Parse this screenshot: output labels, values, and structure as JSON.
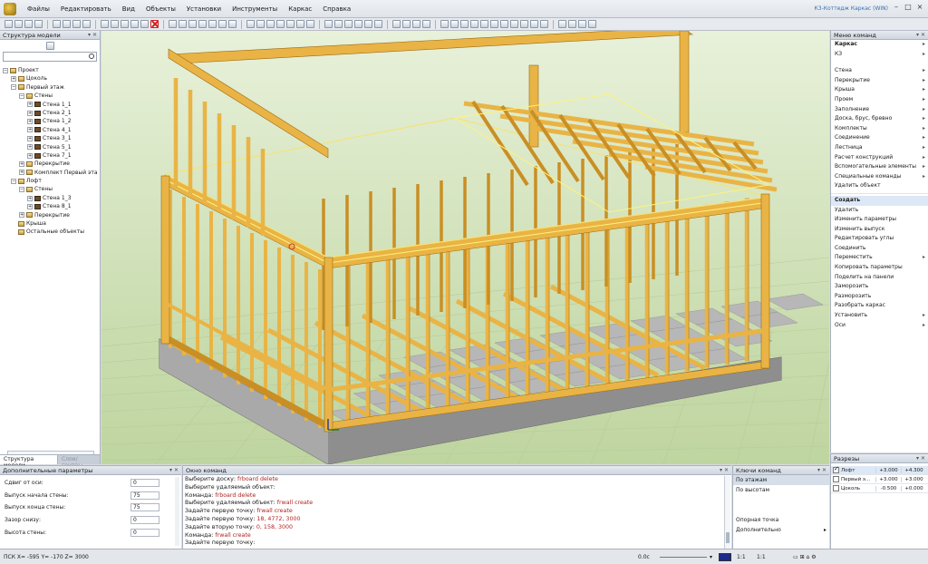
{
  "app": {
    "menus": [
      "Файлы",
      "Редактировать",
      "Вид",
      "Объекты",
      "Установки",
      "Инструменты",
      "Каркас",
      "Справка"
    ],
    "title": "К3-Коттедж Каркас (WIN)",
    "win_controls": {
      "minimize": "–",
      "maximize": "□",
      "close": "×"
    }
  },
  "model_tree": {
    "title": "Структура модели",
    "items": [
      {
        "label": "Проект",
        "level": 0,
        "expander": "−"
      },
      {
        "label": "Цоколь",
        "level": 1,
        "expander": "+"
      },
      {
        "label": "Первый этаж",
        "level": 1,
        "expander": "−"
      },
      {
        "label": "Стены",
        "level": 2,
        "expander": "−"
      },
      {
        "label": "Стена 1_1",
        "level": 3,
        "expander": "+",
        "wall": true
      },
      {
        "label": "Стена 2_1",
        "level": 3,
        "expander": "+",
        "wall": true
      },
      {
        "label": "Стена 1_2",
        "level": 3,
        "expander": "+",
        "wall": true
      },
      {
        "label": "Стена 4_1",
        "level": 3,
        "expander": "+",
        "wall": true
      },
      {
        "label": "Стена 3_1",
        "level": 3,
        "expander": "+",
        "wall": true
      },
      {
        "label": "Стена 5_1",
        "level": 3,
        "expander": "+",
        "wall": true
      },
      {
        "label": "Стена 7_1",
        "level": 3,
        "expander": "+",
        "wall": true
      },
      {
        "label": "Перекрытие",
        "level": 2,
        "expander": "+"
      },
      {
        "label": "Комплект Первый эта",
        "level": 2,
        "expander": "+"
      },
      {
        "label": "Лофт",
        "level": 1,
        "expander": "−"
      },
      {
        "label": "Стены",
        "level": 2,
        "expander": "−"
      },
      {
        "label": "Стена 1_3",
        "level": 3,
        "expander": "+",
        "wall": true
      },
      {
        "label": "Стена 8_1",
        "level": 3,
        "expander": "+",
        "wall": true
      },
      {
        "label": "Перекрытие",
        "level": 2,
        "expander": "+"
      },
      {
        "label": "Крыша",
        "level": 1,
        "expander": ""
      },
      {
        "label": "Остальные объекты",
        "level": 1,
        "expander": ""
      }
    ],
    "tabs": {
      "active": "Структура модели",
      "inactive": "Слои/группы"
    }
  },
  "commands": {
    "title": "Меню команд",
    "top": [
      "Каркас",
      "КЗ"
    ],
    "groups": [
      "Стена",
      "Перекрытие",
      "Крыша",
      "Проем",
      "Заполнение",
      "Доска, брус, бревно",
      "Комплекты",
      "Соединение",
      "Лестница",
      "Расчет конструкций",
      "Вспомогательные элементы",
      "Специальные команды",
      "Удалить объект"
    ],
    "actions": [
      "Создать",
      "Удалить",
      "Изменить параметры",
      "Изменить выпуск",
      "Редактировать углы",
      "Соединить",
      "Переместить",
      "Копировать параметры",
      "Поделить на панели",
      "Заморозить",
      "Разморозить",
      "Разобрать каркас",
      "Установить",
      "Оси"
    ],
    "actions_with_arrow": [
      "Переместить",
      "Установить",
      "Оси"
    ]
  },
  "layers": {
    "title": "Разрезы",
    "rows": [
      {
        "name": "Лофт",
        "checked": true,
        "v1": "+3.000",
        "v2": "+4.300"
      },
      {
        "name": "Первый э...",
        "checked": false,
        "v1": "+3.000",
        "v2": "+3.000"
      },
      {
        "name": "Цоколь",
        "checked": false,
        "v1": "-0.500",
        "v2": "+0.000"
      }
    ]
  },
  "params": {
    "title": "Дополнительные параметры",
    "rows": [
      {
        "label": "Сдвиг от оси:",
        "value": "0"
      },
      {
        "label": "Выпуск начала стены:",
        "value": "75"
      },
      {
        "label": "Выпуск конца стены:",
        "value": "75"
      },
      {
        "label": "Зазор снизу:",
        "value": "0"
      },
      {
        "label": "Высота стены:",
        "value": "0"
      }
    ]
  },
  "command_window": {
    "title": "Окно команд",
    "lines": [
      {
        "prompt": "Выберите доску:",
        "cmd": "frboard delete"
      },
      {
        "prompt": "Выберите удаляемый объект:",
        "cmd": ""
      },
      {
        "prompt": "Команда:",
        "cmd": "frboard delete"
      },
      {
        "prompt": "Выберите удаляемый объект:",
        "cmd": "frwall create"
      },
      {
        "prompt": "Задайте первую точку:",
        "cmd": "frwall create"
      },
      {
        "prompt": "Задайте первую точку:",
        "cmd": "18, 4772, 3000"
      },
      {
        "prompt": "Задайте вторую точку:",
        "cmd": "0, 158, 3000"
      },
      {
        "prompt": "Команда:",
        "cmd": "frwall create"
      },
      {
        "prompt": "Задайте первую точку:",
        "cmd": ""
      }
    ]
  },
  "key_commands": {
    "title": "Ключи команд",
    "items": [
      "По этажам",
      "По высотам",
      "",
      "",
      "Опорная точка",
      "Дополнительно"
    ],
    "selected": "По этажам"
  },
  "status": {
    "coords": "ПСК X= -595   Y= -170   Z= 3000",
    "angle": "0.0с",
    "scale1": "1:1",
    "scale2": "1:1",
    "accent": "#1c2a8c"
  }
}
